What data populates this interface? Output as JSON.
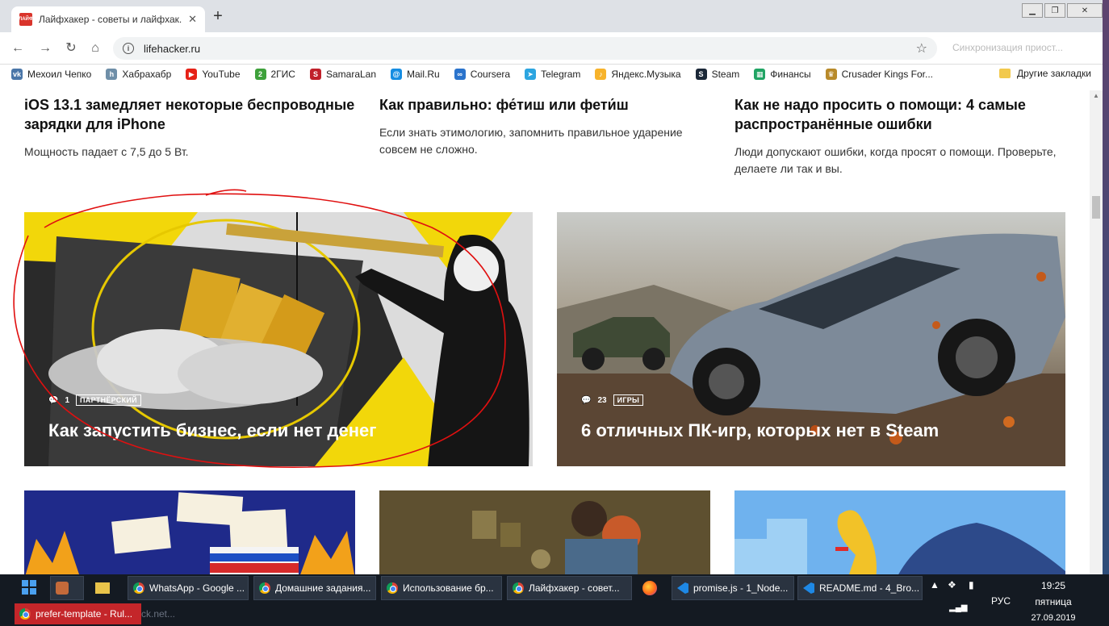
{
  "browser": {
    "tab_title": "Лайфхакер - советы и лайфхак...",
    "tab_close": "✕",
    "new_tab": "+",
    "url": "lifehacker.ru",
    "profile_hint": "Синхронизация приост..."
  },
  "bookmarks": [
    {
      "label": "Мехоил Чепко",
      "icon": "vk-icon",
      "color": "#4a76a8",
      "glyph": "vk"
    },
    {
      "label": "Хабрахабр",
      "icon": "habr-icon",
      "color": "#6f8fa8",
      "glyph": "h"
    },
    {
      "label": "YouTube",
      "icon": "youtube-icon",
      "color": "#e62117",
      "glyph": "▶"
    },
    {
      "label": "2ГИС",
      "icon": "2gis-icon",
      "color": "#3ea13b",
      "glyph": "2"
    },
    {
      "label": "SamaraLan",
      "icon": "samaralan-icon",
      "color": "#c0202a",
      "glyph": "S"
    },
    {
      "label": "Mail.Ru",
      "icon": "mailru-icon",
      "color": "#168de2",
      "glyph": "@"
    },
    {
      "label": "Coursera",
      "icon": "coursera-icon",
      "color": "#2a73cc",
      "glyph": "∞"
    },
    {
      "label": "Telegram",
      "icon": "telegram-icon",
      "color": "#2ca5e0",
      "glyph": "➤"
    },
    {
      "label": "Яндекс.Музыка",
      "icon": "yandex-music-icon",
      "color": "#f7b32b",
      "glyph": "♪"
    },
    {
      "label": "Steam",
      "icon": "steam-icon",
      "color": "#1b2838",
      "glyph": "S"
    },
    {
      "label": "Финансы",
      "icon": "finance-icon",
      "color": "#20a464",
      "glyph": "▦"
    },
    {
      "label": "Crusader Kings For...",
      "icon": "crusader-kings-icon",
      "color": "#b88a2a",
      "glyph": "♛"
    }
  ],
  "other_bookmarks": "Другие закладки",
  "articles_top": [
    {
      "title": "iOS 13.1 замедляет некоторые беспроводные зарядки для iPhone",
      "summary": "Мощность падает с 7,5 до 5 Вт."
    },
    {
      "title": "Как правильно: фе́тиш или фети́ш",
      "summary": "Если знать этимологию, запомнить правильное ударение совсем не сложно."
    },
    {
      "title": "Как не надо просить о помощи: 4 самые распространённые ошибки",
      "summary": "Люди допускают ошибки, когда просят о помощи. Проверьте, делаете ли так и вы."
    }
  ],
  "cards_big": [
    {
      "comments": "1",
      "tag": "ПАРТНЁРСКИЙ",
      "title": "Как запустить бизнес, если нет денег"
    },
    {
      "comments": "23",
      "tag": "ИГРЫ",
      "title": "6 отличных ПК-игр, которых нет в Steam"
    }
  ],
  "taskbar": {
    "items": [
      {
        "label": "WhatsApp - Google ...",
        "icon": "chrome-icon"
      },
      {
        "label": "Домашние задания...",
        "icon": "chrome-icon"
      },
      {
        "label": "Использование бр...",
        "icon": "chrome-icon"
      },
      {
        "label": "Лайфхакер - совет...",
        "icon": "chrome-icon"
      },
      {
        "label": "promise.js - 1_Node...",
        "icon": "vscode-icon"
      },
      {
        "label": "README.md - 4_Bro...",
        "icon": "vscode-icon"
      }
    ],
    "second_row": "prefer-template - Rul...",
    "second_row_faded": "ck.net...",
    "lang": "РУС",
    "time": "19:25",
    "day": "пятница",
    "date": "27.09.2019"
  }
}
